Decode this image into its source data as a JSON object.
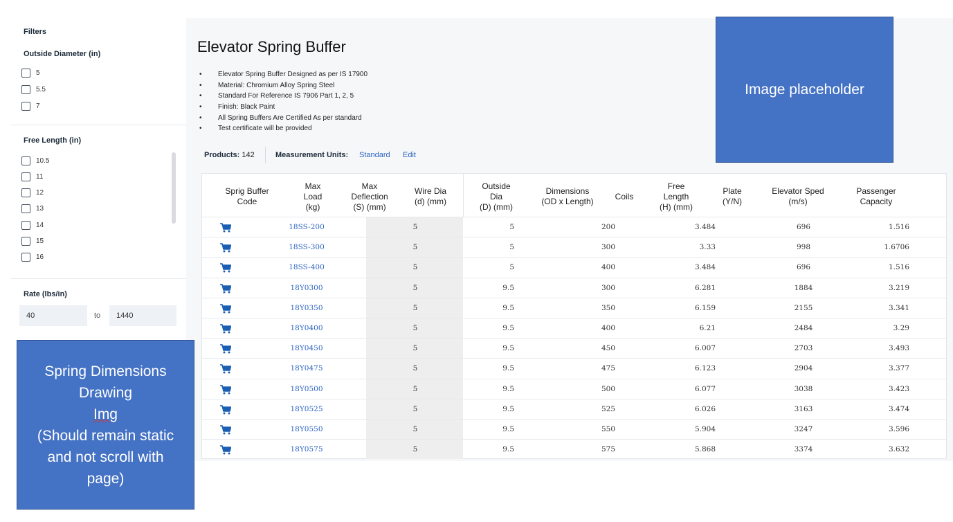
{
  "sidebar": {
    "filters_title": "Filters",
    "outside_diameter": {
      "title": "Outside Diameter (in)",
      "options": [
        "5",
        "5.5",
        "7"
      ]
    },
    "free_length": {
      "title": "Free Length (in)",
      "options": [
        "10.5",
        "11",
        "12",
        "13",
        "14",
        "15",
        "16"
      ]
    },
    "rate": {
      "title": "Rate (lbs/in)",
      "from": "40",
      "to_label": "to",
      "to": "1440"
    }
  },
  "overlay": {
    "drawing": [
      "Spring Dimensions",
      "Drawing",
      "Img",
      "(Should remain static",
      "and not scroll with",
      "page)"
    ],
    "image_placeholder": "Image placeholder"
  },
  "main": {
    "title": "Elevator Spring Buffer",
    "bullets": [
      "Elevator Spring Buffer Designed as per IS 17900",
      "Material: Chromium Alloy Spring Steel",
      "Standard For Reference IS 7906 Part 1, 2, 5",
      "Finish: Black Paint",
      "All Spring Buffers Are Certified As per standard",
      "Test certificate will be provided"
    ],
    "products_label": "Products:",
    "products_count": "142",
    "units_label": "Measurement Units:",
    "units_value": "Standard",
    "edit_label": "Edit"
  },
  "table": {
    "headers": [
      [
        "Sprig Buffer",
        "Code"
      ],
      [
        "Max",
        "Load",
        "(kg)"
      ],
      [
        "Max",
        "Deflection",
        "(S) (mm)"
      ],
      [
        "Wire Dia",
        "(d) (mm)"
      ],
      [
        "Outside",
        "Dia",
        "(D) (mm)"
      ],
      [
        "Dimensions",
        "(OD x Length)"
      ],
      [
        "Coils"
      ],
      [
        "Free",
        "Length",
        "(H) (mm)"
      ],
      [
        "Plate",
        "(Y/N)"
      ],
      [
        "Elevator Sped",
        "(m/s)"
      ],
      [
        "Passenger",
        "Capacity"
      ]
    ],
    "rows": [
      [
        "18SS-200",
        "5",
        "5",
        "200",
        "3.484",
        "696",
        "1.516"
      ],
      [
        "18SS-300",
        "5",
        "5",
        "300",
        "3.33",
        "998",
        "1.6706"
      ],
      [
        "18SS-400",
        "5",
        "5",
        "400",
        "3.484",
        "696",
        "1.516"
      ],
      [
        "18Y0300",
        "5",
        "9.5",
        "300",
        "6.281",
        "1884",
        "3.219"
      ],
      [
        "18Y0350",
        "5",
        "9.5",
        "350",
        "6.159",
        "2155",
        "3.341"
      ],
      [
        "18Y0400",
        "5",
        "9.5",
        "400",
        "6.21",
        "2484",
        "3.29"
      ],
      [
        "18Y0450",
        "5",
        "9.5",
        "450",
        "6.007",
        "2703",
        "3.493"
      ],
      [
        "18Y0475",
        "5",
        "9.5",
        "475",
        "6.123",
        "2904",
        "3.377"
      ],
      [
        "18Y0500",
        "5",
        "9.5",
        "500",
        "6.077",
        "3038",
        "3.423"
      ],
      [
        "18Y0525",
        "5",
        "9.5",
        "525",
        "6.026",
        "3163",
        "3.474"
      ],
      [
        "18Y0550",
        "5",
        "9.5",
        "550",
        "5.904",
        "3247",
        "3.596"
      ],
      [
        "18Y0575",
        "5",
        "9.5",
        "575",
        "5.868",
        "3374",
        "3.632"
      ]
    ]
  },
  "colors": {
    "accent": "#2c64c0",
    "placeholder_blue": "#4472c4"
  },
  "icons": {
    "row_action": "cart-icon"
  }
}
